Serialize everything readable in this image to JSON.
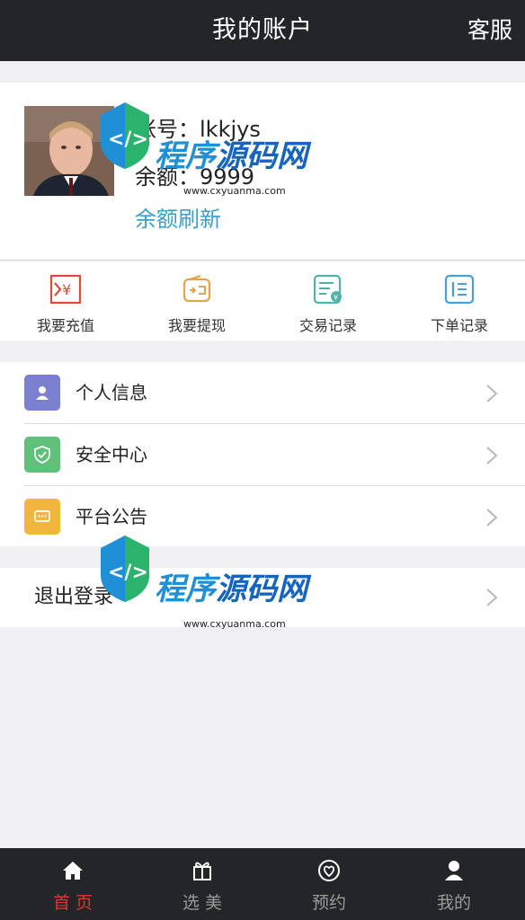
{
  "header": {
    "title": "我的账户",
    "service_label": "客服"
  },
  "profile": {
    "account_label": "账号：",
    "account_value": "lkkjys",
    "balance_label": "余额：",
    "balance_value": "9999",
    "refresh_label": "余额刷新"
  },
  "actions": [
    {
      "label": "我要充值",
      "icon": "recharge-icon",
      "color": "#e0493e"
    },
    {
      "label": "我要提现",
      "icon": "wallet-icon",
      "color": "#e7a34a"
    },
    {
      "label": "交易记录",
      "icon": "transaction-record-icon",
      "color": "#4fb3a8"
    },
    {
      "label": "下单记录",
      "icon": "order-record-icon",
      "color": "#4a9ed6"
    }
  ],
  "menu": [
    {
      "label": "个人信息",
      "icon": "user-icon",
      "color": "#7b7fd0"
    },
    {
      "label": "安全中心",
      "icon": "shield-icon",
      "color": "#5fc07a"
    },
    {
      "label": "平台公告",
      "icon": "message-icon",
      "color": "#f2b53d"
    }
  ],
  "logout_label": "退出登录",
  "tabbar": [
    {
      "label": "首 页",
      "icon": "home-icon",
      "active": true
    },
    {
      "label": "选 美",
      "icon": "gift-icon",
      "active": false
    },
    {
      "label": "预约",
      "icon": "appointment-icon",
      "active": false
    },
    {
      "label": "我的",
      "icon": "person-icon",
      "active": false
    }
  ],
  "watermark": {
    "brand_part1": "程序",
    "brand_part2": "源码网",
    "url": "www.cxyuanma.com"
  },
  "colors": {
    "topbar": "#232528",
    "link": "#3aa0c8",
    "active_tab": "#e0382e"
  }
}
